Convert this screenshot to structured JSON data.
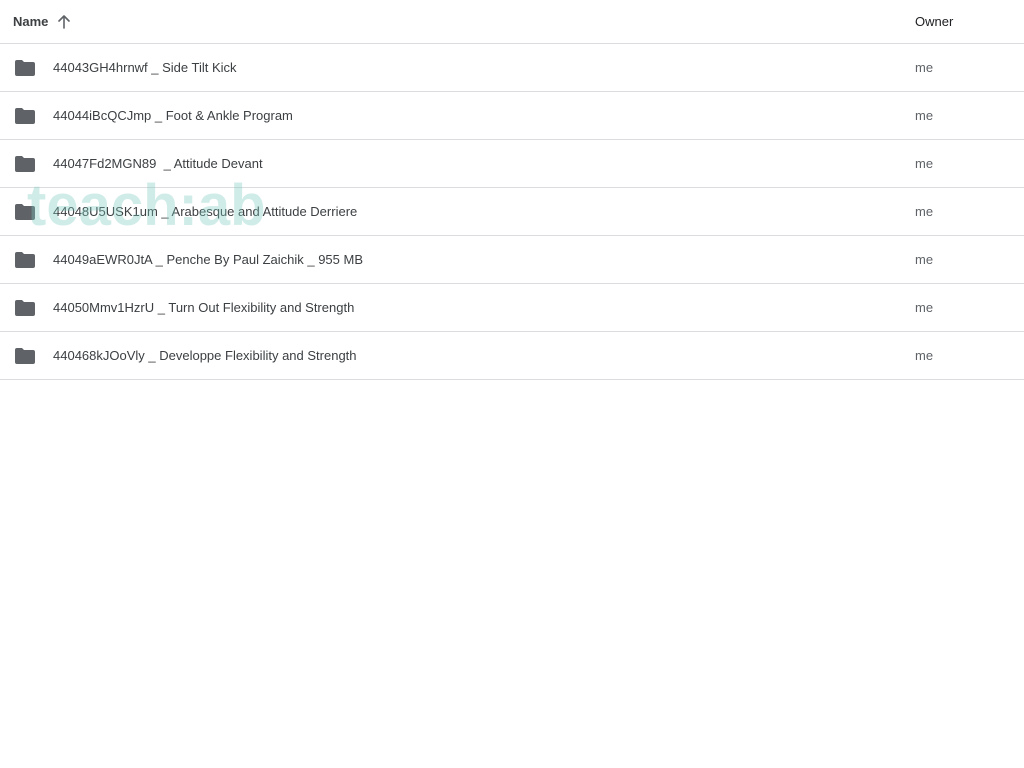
{
  "header": {
    "name_label": "Name",
    "owner_label": "Owner",
    "sort_icon": "arrow-up-icon"
  },
  "rows": [
    {
      "name": "44043GH4hrnwf _ Side Tilt Kick",
      "owner": "me",
      "icon": "folder-icon"
    },
    {
      "name": "44044iBcQCJmp _ Foot & Ankle Program",
      "owner": "me",
      "icon": "folder-icon"
    },
    {
      "name": "44047Fd2MGN89  _ Attitude Devant",
      "owner": "me",
      "icon": "folder-icon"
    },
    {
      "name": "44048U5USK1um _ Arabesque and Attitude Derriere",
      "owner": "me",
      "icon": "folder-icon"
    },
    {
      "name": "44049aEWR0JtA _ Penche By Paul Zaichik _ 955 MB",
      "owner": "me",
      "icon": "folder-icon"
    },
    {
      "name": "44050Mmv1HzrU _ Turn Out Flexibility and Strength",
      "owner": "me",
      "icon": "folder-icon"
    },
    {
      "name": "440468kJOoVly _ Developpe Flexibility and Strength",
      "owner": "me",
      "icon": "folder-icon"
    }
  ],
  "watermark": "teach:ab",
  "colors": {
    "text": "#3c4043",
    "secondary_text": "#5f6368",
    "folder": "#5f6368",
    "divider": "#dadce0",
    "watermark": "#78c8be"
  }
}
